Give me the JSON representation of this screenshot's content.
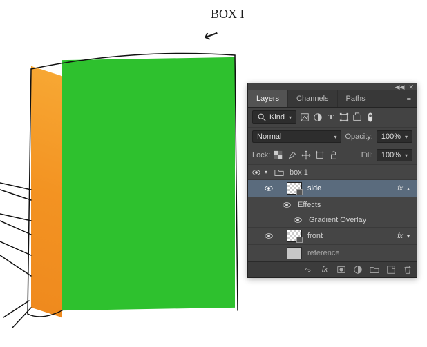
{
  "annotation": {
    "label": "BOX I"
  },
  "panel": {
    "tabs": {
      "layers": "Layers",
      "channels": "Channels",
      "paths": "Paths"
    },
    "filter": {
      "label": "Kind"
    },
    "blend": {
      "mode": "Normal",
      "opacity_label": "Opacity:",
      "opacity_value": "100%"
    },
    "lock": {
      "label": "Lock:",
      "fill_label": "Fill:",
      "fill_value": "100%"
    },
    "layers": {
      "group": "box 1",
      "side": "side",
      "effects": "Effects",
      "grad": "Gradient Overlay",
      "front": "front",
      "ref": "reference"
    },
    "fx_label": "fx"
  }
}
